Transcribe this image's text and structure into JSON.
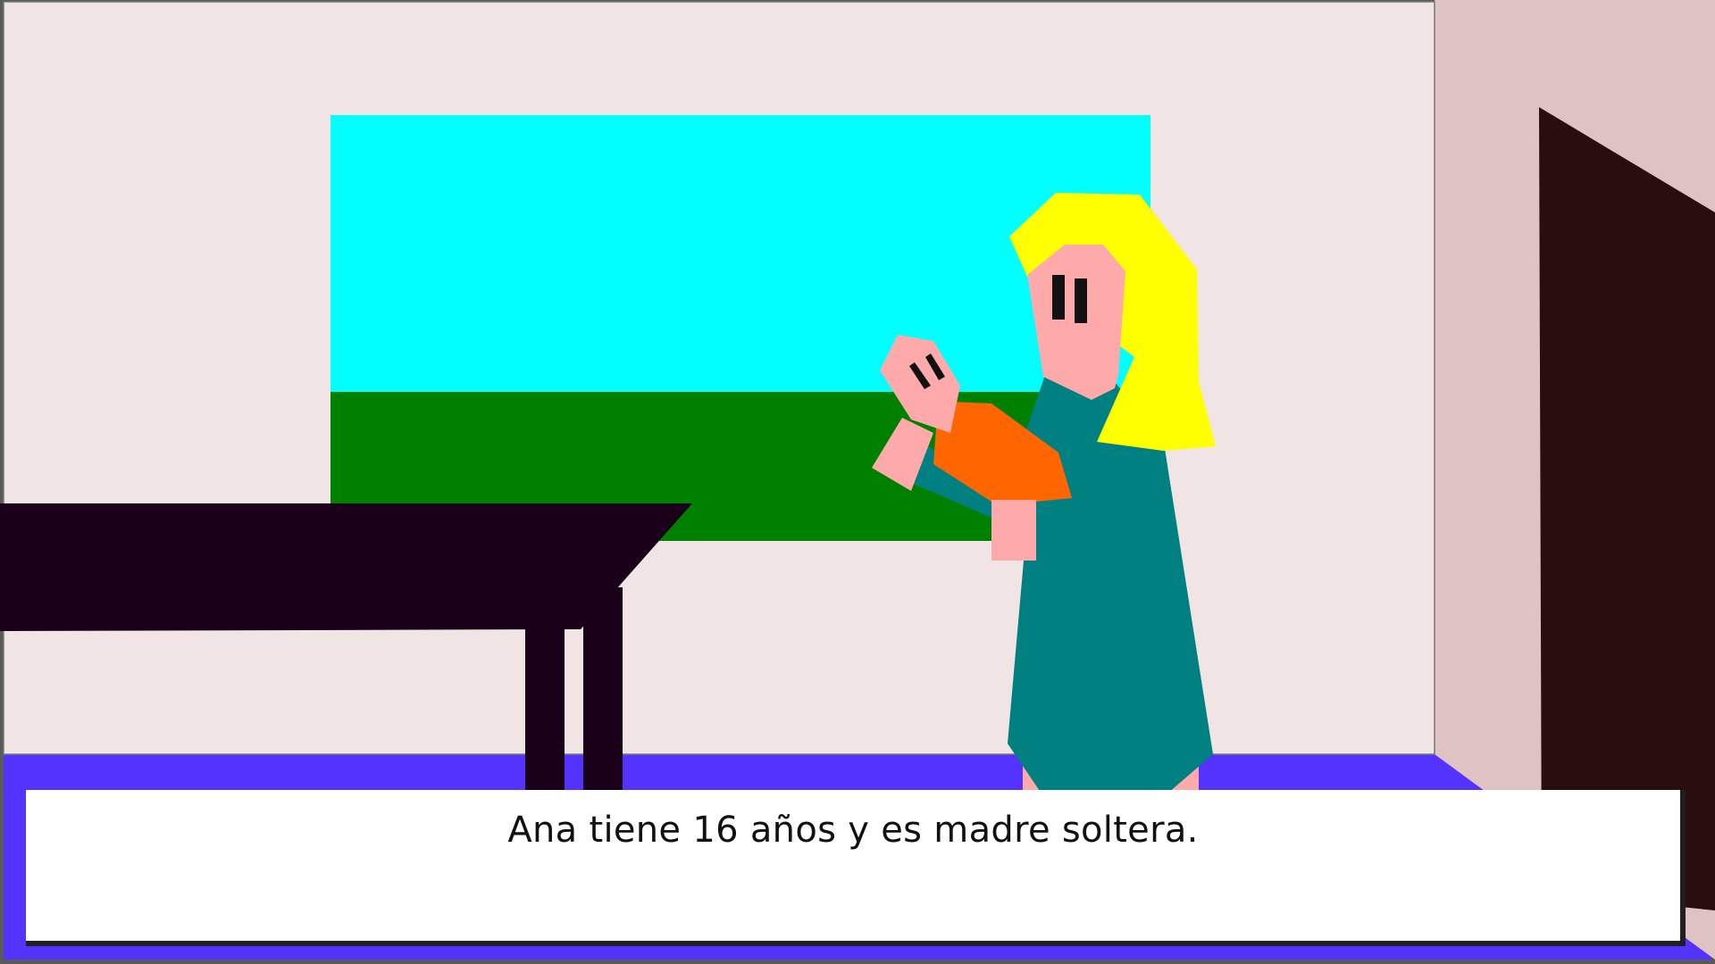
{
  "dialog": {
    "text": "Ana tiene 16 años y es madre soltera."
  },
  "scene": {
    "colors": {
      "back_wall": "#f0e4e4",
      "side_wall": "#dfc3c3",
      "floor": "#5533ff",
      "window_sky": "#00ffff",
      "window_grass": "#008000",
      "table": "#1a0018",
      "door": "#2a0e0e",
      "hair": "#ffff00",
      "skin": "#ffaaaa",
      "dress": "#008080",
      "baby_clothes": "#ff6600",
      "eyes": "#111111"
    },
    "characters": [
      "ana",
      "baby"
    ]
  }
}
